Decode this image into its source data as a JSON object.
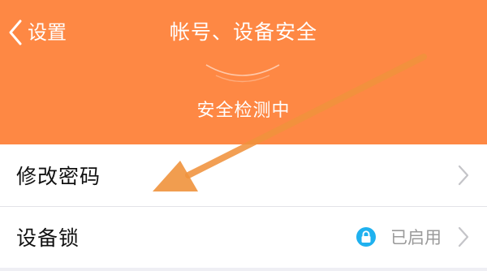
{
  "nav": {
    "back_label": "设置",
    "title": "帐号、设备安全"
  },
  "status": {
    "text": "安全检测中"
  },
  "list": {
    "items": [
      {
        "label": "修改密码",
        "status": ""
      },
      {
        "label": "设备锁",
        "status": "已启用"
      }
    ]
  },
  "icons": {
    "back": "chevron-left-icon",
    "lock": "lock-icon",
    "chevron": "chevron-right-icon"
  },
  "colors": {
    "header_bg": "#fe8844",
    "lock_badge": "#1fb1ef",
    "annotation_arrow": "#f0923c"
  }
}
